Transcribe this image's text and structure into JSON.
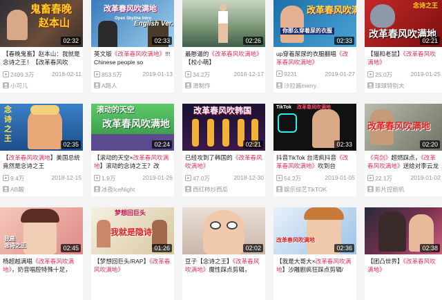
{
  "cards": [
    {
      "overlay": [
        "鬼畜春晚",
        "赵本山"
      ],
      "duration": "02:32",
      "title": "【春晚鬼畜】赵本山：我就是念诗之王！【改革春风吹",
      "views": "2499.3万",
      "date": "2018-02-11",
      "uploader": "小可儿"
    },
    {
      "overlay": [
        "改革春风吹满地",
        "Open Skyline Intro",
        "English Ver."
      ],
      "duration": "02:33",
      "title": "英文版《改革春风吹满地》!!! Chinese people so",
      "views": "853.5万",
      "date": "2019-01-13",
      "uploader": "A路人"
    },
    {
      "overlay": [],
      "duration": "02:26",
      "title": "最憨逼的《改革春风吹满地》【校小萌】",
      "views": "34.2万",
      "date": "2018-12-17",
      "uploader": "滑制作"
    },
    {
      "overlay": [
        "改革春风吹满地",
        "你那么穿着尿的衣服"
      ],
      "duration": "02:33",
      "title": "up穿着尿尿的衣服翻唱《改革春风吹满地》",
      "views": "9231",
      "date": "2019-01-27",
      "uploader": "沙拉酱merry"
    },
    {
      "overlay": [
        "念诗之王",
        "改革春风吹满地"
      ],
      "duration": "02:21",
      "title": "【猫和老鼠】《改革春风吹满地》",
      "views": "25.0万",
      "date": "2019-01-25",
      "uploader": "球球特别大"
    },
    {
      "overlay": [
        "念",
        "诗",
        "之",
        "王"
      ],
      "duration": "02:35",
      "title": "【改革春风吹满地】美国总统竟然是念诗之王",
      "views": "9.4万",
      "date": "2018-12-15",
      "uploader": "AB酸"
    },
    {
      "overlay": [
        "滚动的天空",
        "改革春风吹满地"
      ],
      "duration": "02:24",
      "title": "【滚动的天空×改革春风吹满地】滚动的念诗之王？改",
      "views": "1.9万",
      "date": "2019-01-26",
      "uploader": "冰夜IceNight"
    },
    {
      "overlay": [
        "改革春风吹韩国"
      ],
      "duration": "02:21",
      "title": "已经攻到了韩国的《改革春风吹满地》",
      "views": "47.0万",
      "date": "2018-12-30",
      "uploader": "西红柿炒西瓜"
    },
    {
      "overlay": [
        "TikTok",
        "改革春风吹满地"
      ],
      "duration": "02:33",
      "title": "抖音TikTok 台湾疯抖音《改革春风吹满地》吹到台",
      "views": "54.2万",
      "date": "2019-01-05",
      "uploader": "娱乐综艺TikTOK"
    },
    {
      "overlay": [
        "改革春风吹满地"
      ],
      "duration": "02:20",
      "title": "《亮剑》超燃踩点，《改革春风吹满地》送给对李云龙下手",
      "views": "22.1万",
      "date": "2019-01-02",
      "uploader": "影片控剧机"
    },
    {
      "overlay": [
        "我是",
        "念诗之王"
      ],
      "duration": "02:45",
      "title": "杨超越满唱《改革春风吹满地》，奶音唱腔特殊十足，",
      "views": "",
      "date": "",
      "uploader": ""
    },
    {
      "overlay": [
        "梦想回巨头",
        "我就是隐诗"
      ],
      "duration": "01:26",
      "title": "【梦想回巨头/RAP】《改革春风吹满地》",
      "views": "",
      "date": "",
      "uploader": ""
    },
    {
      "overlay": [],
      "duration": "02:02",
      "title": "豆子【念诗之王】《改革春风吹满地》魔性踩点剪辑，",
      "views": "",
      "date": "",
      "uploader": ""
    },
    {
      "overlay": [
        "改革春风吹满地"
      ],
      "duration": "02:36",
      "title": "【我是大哥大×改革春风吹满地】沙雕剧疯狂踩点剪辑/",
      "views": "",
      "date": "",
      "uploader": ""
    },
    {
      "overlay": [],
      "duration": "02:38",
      "title": "【团凸世界】《改革春风吹满地》",
      "views": "",
      "date": "",
      "uploader": ""
    }
  ],
  "colors": {
    "highlight": "#e0315b",
    "meta": "#999999",
    "duration_bg": "rgba(0,0,0,0.7)"
  }
}
